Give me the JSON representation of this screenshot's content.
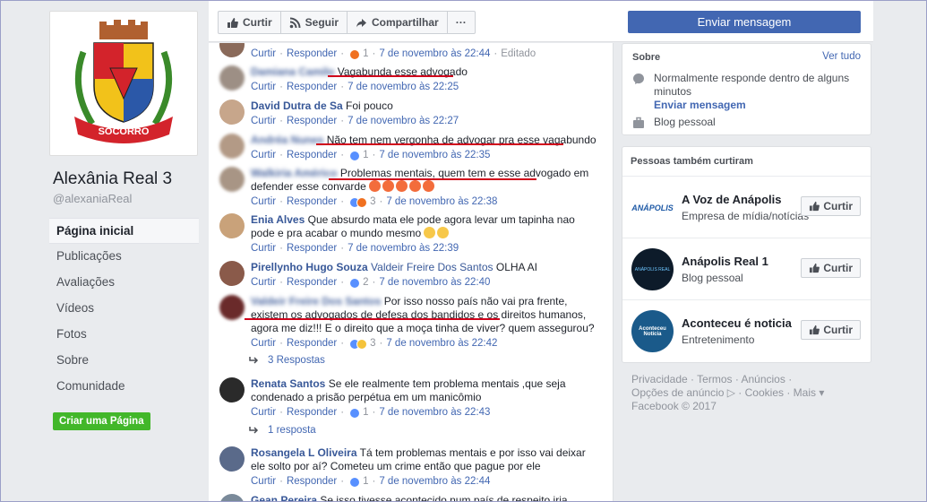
{
  "left": {
    "page_name": "Alexânia Real 3",
    "handle": "@alexaniaReal",
    "crest_text": "SOCORRO",
    "nav": [
      "Página inicial",
      "Publicações",
      "Avaliações",
      "Vídeos",
      "Fotos",
      "Sobre",
      "Comunidade"
    ],
    "create_page": "Criar uma Página"
  },
  "topbar": {
    "like": "Curtir",
    "follow": "Seguir",
    "share": "Compartilhar",
    "more": "···",
    "send_message": "Enviar mensagem"
  },
  "comments": [
    {
      "author": "",
      "text": "",
      "like": "Curtir",
      "reply": "Responder",
      "reactions": "1",
      "time": "7 de novembro às 22:44",
      "edited": "Editado"
    },
    {
      "author": "Damiana Camilo",
      "text": "Vagabunda esse advogado",
      "like": "Curtir",
      "reply": "Responder",
      "time": "7 de novembro às 22:25"
    },
    {
      "author": "David Dutra de Sa",
      "text": "Foi pouco",
      "like": "Curtir",
      "reply": "Responder",
      "time": "7 de novembro às 22:27"
    },
    {
      "author": "Andréa Nunes",
      "text": "Não tem nem vergonha de advogar pra esse vagabundo",
      "like": "Curtir",
      "reply": "Responder",
      "reactions": "1",
      "time": "7 de novembro às 22:35"
    },
    {
      "author": "Walkiria Américo",
      "text": "Problemas mentais, quem tem e esse advogado em defender esse convarde",
      "like": "Curtir",
      "reply": "Responder",
      "reactions": "3",
      "time": "7 de novembro às 22:38"
    },
    {
      "author": "Enia Alves",
      "text": "Que absurdo mata ele pode agora levar um tapinha nao pode e pra acabar o mundo mesmo",
      "like": "Curtir",
      "reply": "Responder",
      "time": "7 de novembro às 22:39"
    },
    {
      "author": "Pirellynho Hugo Souza",
      "mention": "Valdeir Freire Dos Santos",
      "text": "OLHA AI",
      "like": "Curtir",
      "reply": "Responder",
      "reactions": "2",
      "time": "7 de novembro às 22:40"
    },
    {
      "author": "Valdeir Freire Dos Santos",
      "text": "Por isso nosso país não vai pra frente, existem os advogados de defesa dos bandidos e os direitos humanos, agora me diz!!! E o direito que a moça tinha de viver? quem assegurou?",
      "like": "Curtir",
      "reply": "Responder",
      "reactions": "3",
      "time": "7 de novembro às 22:42",
      "replies": "3 Respostas"
    },
    {
      "author": "Renata Santos",
      "text": "Se ele realmente tem problema mentais ,que seja condenado a prisão perpétua em um manicômio",
      "like": "Curtir",
      "reply": "Responder",
      "reactions": "1",
      "time": "7 de novembro às 22:43",
      "replies": "1 resposta"
    },
    {
      "author": "Rosangela L Oliveira",
      "text": "Tá tem problemas mentais e por isso vai deixar ele solto por aí? Cometeu um crime então que pague por ele",
      "like": "Curtir",
      "reply": "Responder",
      "reactions": "1",
      "time": "7 de novembro às 22:44"
    },
    {
      "author": "Gean Pereira",
      "text": "Se isso tivesse acontecido num país de respeito iria receber"
    }
  ],
  "about": {
    "title": "Sobre",
    "see_all": "Ver tudo",
    "response": "Normalmente responde dentro de alguns minutos",
    "send_message": "Enviar mensagem",
    "category": "Blog pessoal"
  },
  "liked": {
    "title": "Pessoas também curtiram",
    "button": "Curtir",
    "pages": [
      {
        "name": "A Voz de Anápolis",
        "category": "Empresa de mídia/notícias",
        "logo_text": "ANÁPOLIS"
      },
      {
        "name": "Anápolis Real 1",
        "category": "Blog pessoal",
        "logo_text": "ANÁPOLIS REAL"
      },
      {
        "name": "Aconteceu é noticia",
        "category": "Entretenimento",
        "logo_text": "Aconteceu Notícia"
      }
    ]
  },
  "footer": {
    "line1": "Privacidade · Termos · Anúncios ·",
    "line2": "Opções de anúncio ▷ · Cookies · Mais ▾",
    "line3": "Facebook © 2017"
  }
}
